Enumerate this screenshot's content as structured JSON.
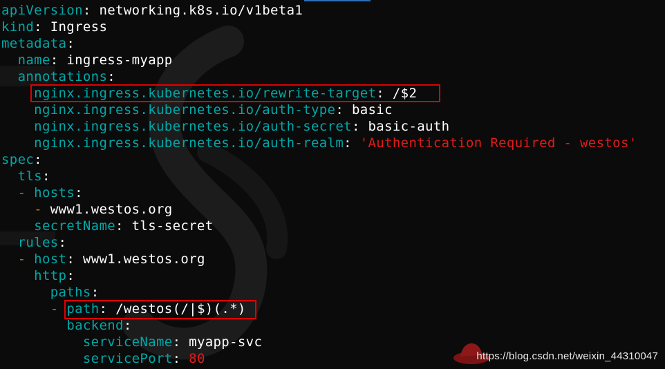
{
  "editor": {
    "lines": [
      [
        {
          "c": "k",
          "t": "apiVersion"
        },
        {
          "c": "w",
          "t": ": "
        },
        {
          "c": "w",
          "t": "networking.k8s.io/v1beta1"
        }
      ],
      [
        {
          "c": "k",
          "t": "kind"
        },
        {
          "c": "w",
          "t": ": "
        },
        {
          "c": "w",
          "t": "Ingress"
        }
      ],
      [
        {
          "c": "k",
          "t": "metadata"
        },
        {
          "c": "w",
          "t": ":"
        }
      ],
      [
        {
          "c": "w",
          "t": "  "
        },
        {
          "c": "k",
          "t": "name"
        },
        {
          "c": "w",
          "t": ": "
        },
        {
          "c": "w",
          "t": "ingress-myapp"
        }
      ],
      [
        {
          "c": "w",
          "t": "  "
        },
        {
          "c": "k",
          "t": "annotations"
        },
        {
          "c": "w",
          "t": ":"
        }
      ],
      [
        {
          "c": "w",
          "t": "    "
        },
        {
          "c": "k",
          "t": "nginx.ingress.kubernetes.io/rewrite-target"
        },
        {
          "c": "w",
          "t": ": "
        },
        {
          "c": "w",
          "t": "/$2"
        }
      ],
      [
        {
          "c": "w",
          "t": "    "
        },
        {
          "c": "k",
          "t": "nginx.ingress.kubernetes.io/auth-type"
        },
        {
          "c": "w",
          "t": ": "
        },
        {
          "c": "w",
          "t": "basic"
        }
      ],
      [
        {
          "c": "w",
          "t": "    "
        },
        {
          "c": "k",
          "t": "nginx.ingress.kubernetes.io/auth-secret"
        },
        {
          "c": "w",
          "t": ": "
        },
        {
          "c": "w",
          "t": "basic-auth"
        }
      ],
      [
        {
          "c": "w",
          "t": "    "
        },
        {
          "c": "k",
          "t": "nginx.ingress.kubernetes.io/auth-realm"
        },
        {
          "c": "w",
          "t": ": "
        },
        {
          "c": "s",
          "t": "'Authentication Required - westos'"
        }
      ],
      [
        {
          "c": "k",
          "t": "spec"
        },
        {
          "c": "w",
          "t": ":"
        }
      ],
      [
        {
          "c": "w",
          "t": "  "
        },
        {
          "c": "k",
          "t": "tls"
        },
        {
          "c": "w",
          "t": ":"
        }
      ],
      [
        {
          "c": "w",
          "t": "  "
        },
        {
          "c": "d",
          "t": "-"
        },
        {
          "c": "w",
          "t": " "
        },
        {
          "c": "k",
          "t": "hosts"
        },
        {
          "c": "w",
          "t": ":"
        }
      ],
      [
        {
          "c": "w",
          "t": "    "
        },
        {
          "c": "d",
          "t": "-"
        },
        {
          "c": "w",
          "t": " "
        },
        {
          "c": "w",
          "t": "www1.westos.org"
        }
      ],
      [
        {
          "c": "w",
          "t": "    "
        },
        {
          "c": "k",
          "t": "secretName"
        },
        {
          "c": "w",
          "t": ": "
        },
        {
          "c": "w",
          "t": "tls-secret"
        }
      ],
      [
        {
          "c": "w",
          "t": "  "
        },
        {
          "c": "k",
          "t": "rules"
        },
        {
          "c": "w",
          "t": ":"
        }
      ],
      [
        {
          "c": "w",
          "t": "  "
        },
        {
          "c": "d",
          "t": "-"
        },
        {
          "c": "w",
          "t": " "
        },
        {
          "c": "k",
          "t": "host"
        },
        {
          "c": "w",
          "t": ": "
        },
        {
          "c": "w",
          "t": "www1.westos.org"
        }
      ],
      [
        {
          "c": "w",
          "t": "    "
        },
        {
          "c": "k",
          "t": "http"
        },
        {
          "c": "w",
          "t": ":"
        }
      ],
      [
        {
          "c": "w",
          "t": "      "
        },
        {
          "c": "k",
          "t": "paths"
        },
        {
          "c": "w",
          "t": ":"
        }
      ],
      [
        {
          "c": "w",
          "t": "      "
        },
        {
          "c": "d",
          "t": "-"
        },
        {
          "c": "w",
          "t": " "
        },
        {
          "c": "k",
          "t": "path"
        },
        {
          "c": "w",
          "t": ": "
        },
        {
          "c": "w",
          "t": "/westos(/|$)(.*)"
        }
      ],
      [
        {
          "c": "w",
          "t": "        "
        },
        {
          "c": "k",
          "t": "backend"
        },
        {
          "c": "w",
          "t": ":"
        }
      ],
      [
        {
          "c": "w",
          "t": "          "
        },
        {
          "c": "k",
          "t": "serviceName"
        },
        {
          "c": "w",
          "t": ": "
        },
        {
          "c": "w",
          "t": "myapp-svc"
        }
      ],
      [
        {
          "c": "w",
          "t": "          "
        },
        {
          "c": "k",
          "t": "servicePort"
        },
        {
          "c": "w",
          "t": ": "
        },
        {
          "c": "n",
          "t": "80"
        }
      ]
    ]
  },
  "watermark": {
    "text": "https://blog.csdn.net/weixin_44310047"
  },
  "colors": {
    "background": "#0b0b0b",
    "key": "#00a8a8",
    "value": "#ffffff",
    "dash": "#c87000",
    "string": "#e01b1b",
    "highlight_box": "#e00000"
  }
}
